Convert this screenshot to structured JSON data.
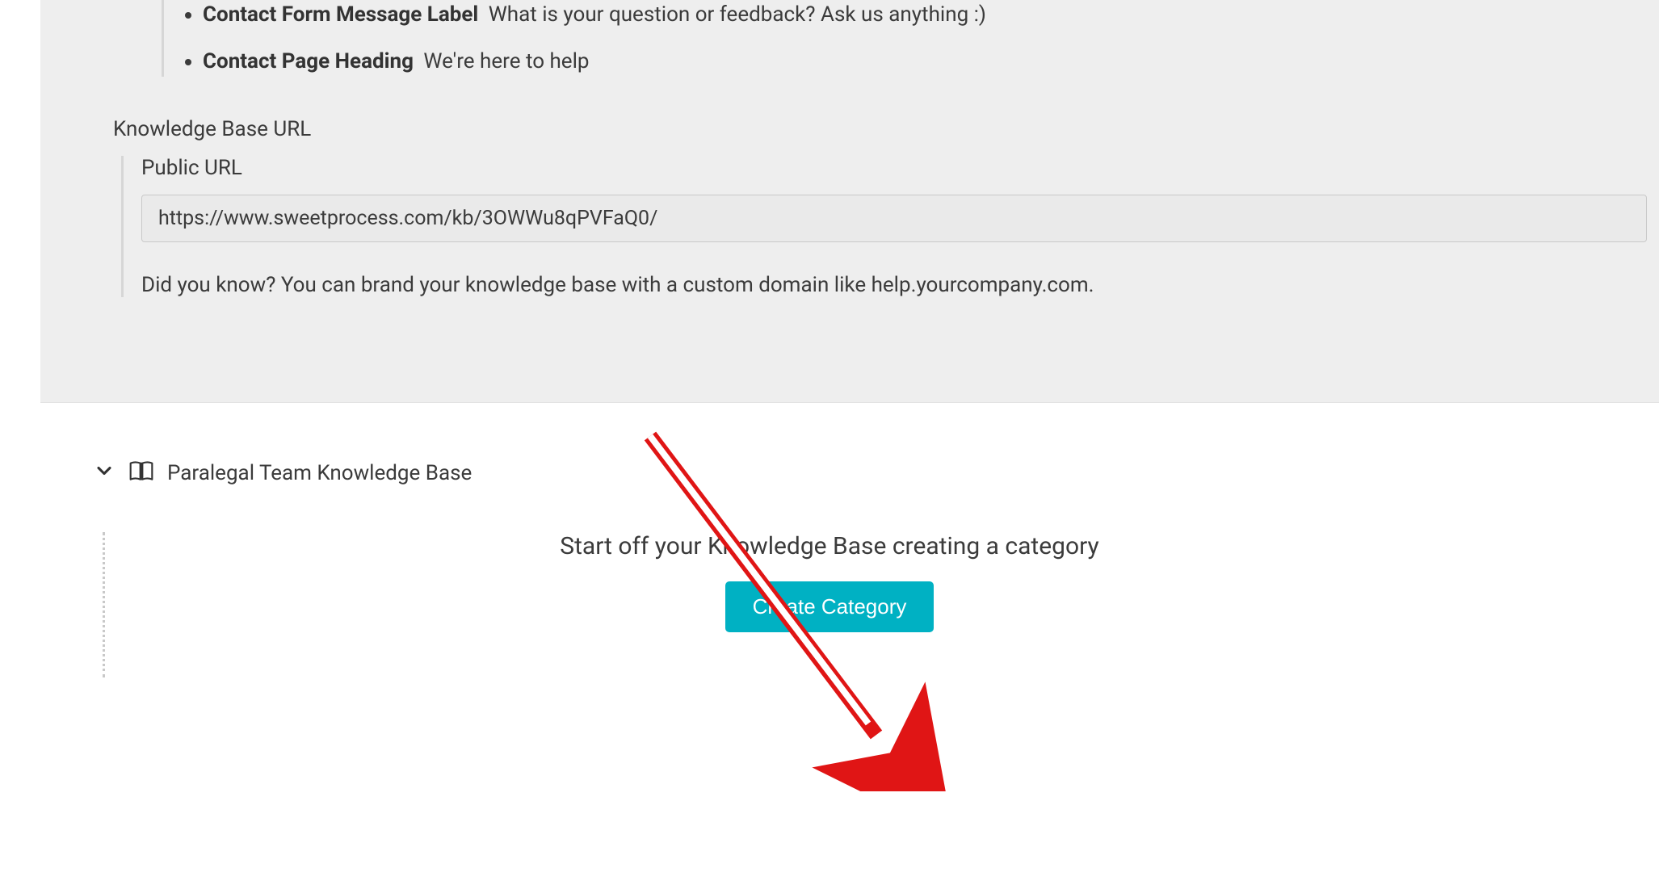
{
  "settings": {
    "bullets": [
      {
        "label": "Contact Form Message Label",
        "value": "What is your question or feedback? Ask us anything :)"
      },
      {
        "label": "Contact Page Heading",
        "value": "We're here to help"
      }
    ],
    "kb_url_heading": "Knowledge Base URL",
    "public_url_label": "Public URL",
    "public_url_value": "https://www.sweetprocess.com/kb/3OWWu8qPVFaQ0/",
    "url_hint": "Did you know? You can brand your knowledge base with a custom domain like help.yourcompany.com."
  },
  "kb": {
    "title": "Paralegal Team Knowledge Base",
    "start_text": "Start off your Knowledge Base creating a category",
    "create_button_label": "Create Category"
  }
}
